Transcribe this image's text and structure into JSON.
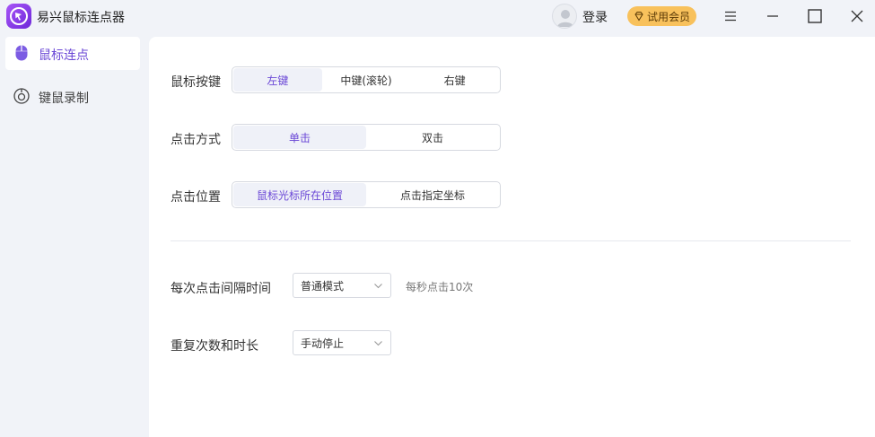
{
  "app": {
    "title": "易兴鼠标连点器",
    "logo_icon": "cursor-target-icon"
  },
  "header": {
    "login_label": "登录",
    "vip_label": "试用会员",
    "vip_icon": "diamond-icon",
    "buttons": [
      "menu-icon",
      "minimize-icon",
      "maximize-icon",
      "close-icon"
    ]
  },
  "sidebar": {
    "items": [
      {
        "label": "鼠标连点",
        "icon": "mouse-icon",
        "active": true
      },
      {
        "label": "键鼠录制",
        "icon": "record-icon",
        "active": false
      }
    ]
  },
  "settings": {
    "mouse_button": {
      "label": "鼠标按键",
      "options": [
        "左键",
        "中键(滚轮)",
        "右键"
      ],
      "selected": 0
    },
    "click_type": {
      "label": "点击方式",
      "options": [
        "单击",
        "双击"
      ],
      "selected": 0
    },
    "click_position": {
      "label": "点击位置",
      "options": [
        "鼠标光标所在位置",
        "点击指定坐标"
      ],
      "selected": 0
    },
    "interval": {
      "label": "每次点击间隔时间",
      "value": "普通模式",
      "hint": "每秒点击10次"
    },
    "repeat": {
      "label": "重复次数和时长",
      "value": "手动停止"
    }
  },
  "colors": {
    "accent": "#6b48d6",
    "vip": "#f8c15c",
    "logo": "#8b3dea"
  }
}
